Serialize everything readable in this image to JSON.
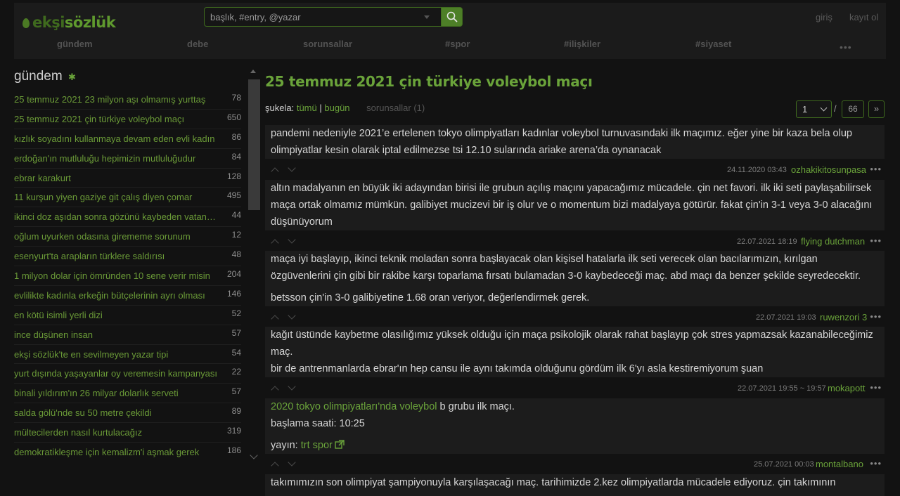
{
  "header": {
    "logo_part1": "ekşi",
    "logo_part2": "sözlük",
    "search_placeholder": "başlık, #entry, @yazar",
    "login": "giriş",
    "register": "kayıt ol",
    "nav": [
      "gündem",
      "debe",
      "sorunsallar",
      "#spor",
      "#ilişkiler",
      "#siyaset"
    ],
    "nav_more": "•••"
  },
  "sidebar": {
    "title": "gündem",
    "topics": [
      {
        "title": "25 temmuz 2021 23 milyon aşı olmamış yurttaş",
        "count": "78"
      },
      {
        "title": "25 temmuz 2021 çin türkiye voleybol maçı",
        "count": "650"
      },
      {
        "title": "kızlık soyadını kullanmaya devam eden evli kadın",
        "count": "86"
      },
      {
        "title": "erdoğan'ın mutluluğu hepimizin mutluluğudur",
        "count": "84"
      },
      {
        "title": "ebrar karakurt",
        "count": "128"
      },
      {
        "title": "11 kurşun yiyen gaziye git çalış diyen çomar",
        "count": "495"
      },
      {
        "title": "ikinci doz aşıdan sonra gözünü kaybeden vatandaş",
        "count": "44"
      },
      {
        "title": "oğlum uyurken odasına girememe sorunum",
        "count": "12"
      },
      {
        "title": "esenyurt'ta arapların türklere saldırısı",
        "count": "48"
      },
      {
        "title": "1 milyon dolar için ömründen 10 sene verir misin",
        "count": "204"
      },
      {
        "title": "evlilikte kadınla erkeğin bütçelerinin ayrı olması",
        "count": "146"
      },
      {
        "title": "en kötü isimli yerli dizi",
        "count": "52"
      },
      {
        "title": "ince düşünen insan",
        "count": "57"
      },
      {
        "title": "ekşi sözlük'te en sevilmeyen yazar tipi",
        "count": "54"
      },
      {
        "title": "yurt dışında yaşayanlar oy veremesin kampanyası",
        "count": "22"
      },
      {
        "title": "binali yıldırım'ın 26 milyar dolarlık serveti",
        "count": "57"
      },
      {
        "title": "salda gölü'nde su 50 metre çekildi",
        "count": "89"
      },
      {
        "title": "mültecilerden nasıl kurtulacağız",
        "count": "319"
      },
      {
        "title": "demokratikleşme için kemalizm'i aşmak gerek",
        "count": "186"
      }
    ]
  },
  "main": {
    "title": "25 temmuz 2021 çin türkiye voleybol maçı",
    "sukela_label": "şukela:",
    "sukela_all": "tümü",
    "sukela_sep": "|",
    "sukela_today": "bugün",
    "sorunsallar": "sorunsallar (1)",
    "page_current": "1",
    "page_sep": "/",
    "page_total": "66",
    "page_next": "»",
    "entries": [
      {
        "p1": "pandemi nedeniyle 2021’e ertelenen tokyo olimpiyatları kadınlar voleybol turnuvasındaki ilk maçımız. eğer yine bir kaza bela olup olimpiyatlar kesin olarak iptal edilmezse tsi 12.10 sularında ariake arena’da oynanacak",
        "date": "24.11.2020 03:43",
        "author": "ozhakikitosunpasa"
      },
      {
        "p1": "altın madalyanın en büyük iki adayından birisi ile grubun açılış maçını yapacağımız mücadele. çin net favori. ilk iki seti paylaşabilirsek maça ortak olmamız mümkün. galibiyet mucizevi bir iş olur ve o momentum bizi madalyaya götürür. fakat çin'in 3-1 veya 3-0 alacağını düşünüyorum",
        "date": "22.07.2021 18:19",
        "author": "flying dutchman"
      },
      {
        "p1": "maça iyi başlayıp, ikinci teknik moladan sonra başlayacak olan kişisel hatalarla ilk seti verecek olan bacılarımızın, kırılgan özgüvenlerini çin gibi bir rakibe karşı toparlama fırsatı bulamadan 3-0 kaybedeceği maç. abd maçı da benzer şekilde seyredecektir.",
        "p2": "betsson çin'in 3-0 galibiyetine 1.68 oran veriyor, değerlendirmek gerek.",
        "date": "22.07.2021 19:03",
        "author": "ruwenzori 3"
      },
      {
        "p1": "kağıt üstünde kaybetme olasılığımız yüksek olduğu için maça psikolojik olarak rahat başlayıp çok stres yapmazsak kazanabileceğimiz maç.",
        "p2": "bir de antrenmanlarda ebrar'ın hep cansu ile aynı takımda olduğunu gördüm ilk 6'yı asla kestiremiyorum şuan",
        "date": "22.07.2021 19:55 ~ 19:57",
        "author": "mokapott"
      },
      {
        "link1": "2020 tokyo olimpiyatları'nda voleybol",
        "p1_rest": " b grubu ilk maçı.",
        "p2": "başlama saati: 10:25",
        "p3_label": "yayın: ",
        "link2": "trt spor",
        "date": "25.07.2021 00:03",
        "author": "montalbano"
      },
      {
        "p1": "takımımızın son olimpiyat şampiyonuyla karşılaşacağı maç. tarihimizde 2.kez olimpiyatlarda mücadele ediyoruz. çin takımının"
      }
    ]
  }
}
